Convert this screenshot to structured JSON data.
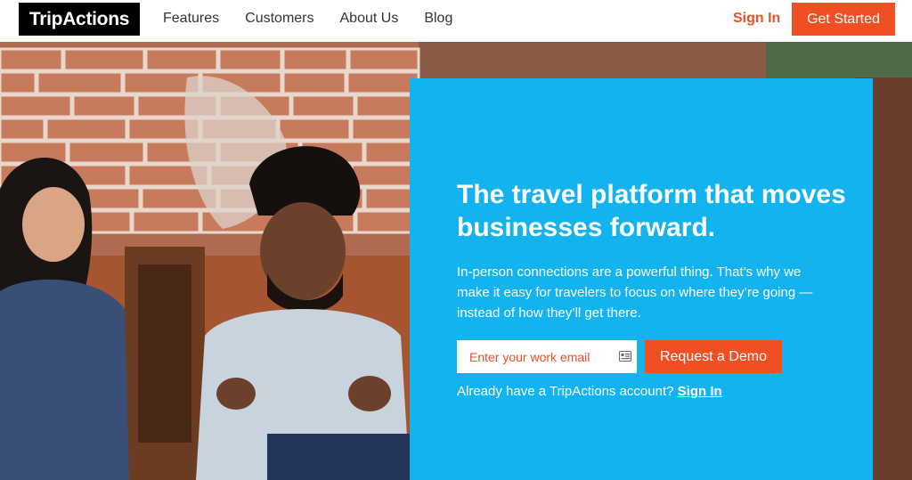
{
  "header": {
    "logo": "TripActions",
    "nav": [
      "Features",
      "Customers",
      "About Us",
      "Blog"
    ],
    "sign_in": "Sign In",
    "get_started": "Get Started"
  },
  "hero": {
    "headline": "The travel platform that moves businesses forward.",
    "subtext": "In-person connections are a powerful thing. That’s why we make it easy for travelers to focus on where they’re going — instead of how they’ll get there.",
    "email_placeholder": "Enter your work email",
    "demo_button": "Request a Demo",
    "account_prompt": "Already have a TripActions account?",
    "account_sign_in": "Sign In"
  },
  "colors": {
    "accent": "#f04e23",
    "panel": "#12b3ef",
    "logo_bg": "#000000"
  },
  "icons": {
    "email_field_icon": "contact-card-icon"
  }
}
